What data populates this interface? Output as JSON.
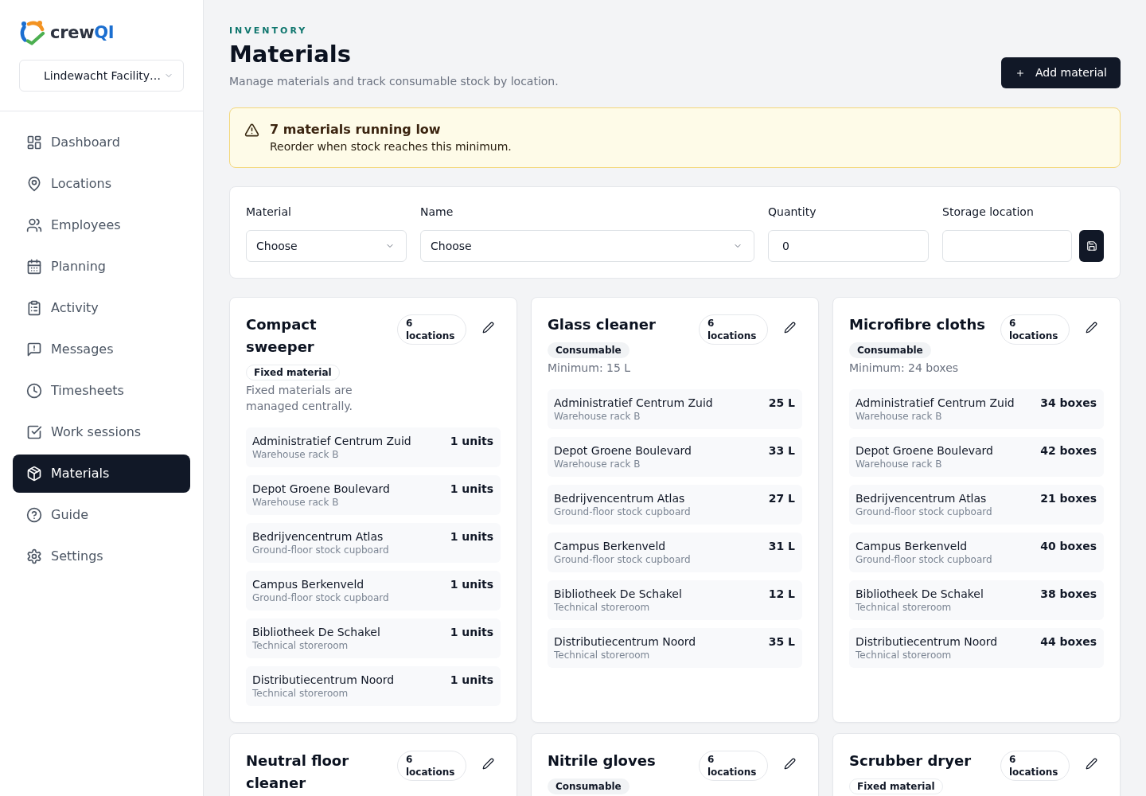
{
  "sidebar": {
    "logo": {
      "text": "crew",
      "accent": "QI"
    },
    "organization": {
      "value": "Lindewacht Facility…"
    },
    "nav": [
      {
        "label": "Dashboard",
        "selected": false
      },
      {
        "label": "Locations",
        "selected": false
      },
      {
        "label": "Employees",
        "selected": false
      },
      {
        "label": "Planning",
        "selected": false
      },
      {
        "label": "Activity",
        "selected": false
      },
      {
        "label": "Messages",
        "selected": false
      },
      {
        "label": "Timesheets",
        "selected": false
      },
      {
        "label": "Work sessions",
        "selected": false
      },
      {
        "label": "Materials",
        "selected": true
      },
      {
        "label": "Guide",
        "selected": false
      },
      {
        "label": "Settings",
        "selected": false
      }
    ]
  },
  "header": {
    "eyebrow": "INVENTORY",
    "title": "Materials",
    "subtitle": "Manage materials and track consumable stock by location.",
    "action": "Add material"
  },
  "alert": {
    "title": "7 materials running low",
    "message": "Reorder when stock reaches this minimum."
  },
  "stock_form": {
    "fields": [
      {
        "kind": "select",
        "label": "Material",
        "value": "Choose"
      },
      {
        "kind": "select",
        "label": "Name",
        "value": "Choose"
      },
      {
        "kind": "input",
        "label": "Quantity",
        "value": "0"
      },
      {
        "kind": "input",
        "label": "Storage location"
      }
    ]
  },
  "materials": [
    {
      "name": "Compact sweeper",
      "locations": "6 locations",
      "type": {
        "kind": "fixed",
        "label": "Fixed material"
      },
      "note": "Fixed materials are managed centrally.",
      "stock": [
        {
          "location": "Administratief Centrum Zuid",
          "storage": "Warehouse rack B",
          "quantity": "1 units"
        },
        {
          "location": "Depot Groene Boulevard",
          "storage": "Warehouse rack B",
          "quantity": "1 units"
        },
        {
          "location": "Bedrijvencentrum Atlas",
          "storage": "Ground-floor stock cupboard",
          "quantity": "1 units"
        },
        {
          "location": "Campus Berkenveld",
          "storage": "Ground-floor stock cupboard",
          "quantity": "1 units"
        },
        {
          "location": "Bibliotheek De Schakel",
          "storage": "Technical storeroom",
          "quantity": "1 units"
        },
        {
          "location": "Distributiecentrum Noord",
          "storage": "Technical storeroom",
          "quantity": "1 units"
        }
      ]
    },
    {
      "name": "Glass cleaner",
      "locations": "6 locations",
      "type": {
        "kind": "consumable",
        "label": "Consumable"
      },
      "note": "Minimum: 15 L",
      "stock": [
        {
          "location": "Administratief Centrum Zuid",
          "storage": "Warehouse rack B",
          "quantity": "25 L"
        },
        {
          "location": "Depot Groene Boulevard",
          "storage": "Warehouse rack B",
          "quantity": "33 L"
        },
        {
          "location": "Bedrijvencentrum Atlas",
          "storage": "Ground-floor stock cupboard",
          "quantity": "27 L"
        },
        {
          "location": "Campus Berkenveld",
          "storage": "Ground-floor stock cupboard",
          "quantity": "31 L"
        },
        {
          "location": "Bibliotheek De Schakel",
          "storage": "Technical storeroom",
          "quantity": "12 L"
        },
        {
          "location": "Distributiecentrum Noord",
          "storage": "Technical storeroom",
          "quantity": "35 L"
        }
      ]
    },
    {
      "name": "Microfibre cloths",
      "locations": "6 locations",
      "type": {
        "kind": "consumable",
        "label": "Consumable"
      },
      "note": "Minimum: 24 boxes",
      "stock": [
        {
          "location": "Administratief Centrum Zuid",
          "storage": "Warehouse rack B",
          "quantity": "34 boxes"
        },
        {
          "location": "Depot Groene Boulevard",
          "storage": "Warehouse rack B",
          "quantity": "42 boxes"
        },
        {
          "location": "Bedrijvencentrum Atlas",
          "storage": "Ground-floor stock cupboard",
          "quantity": "21 boxes"
        },
        {
          "location": "Campus Berkenveld",
          "storage": "Ground-floor stock cupboard",
          "quantity": "40 boxes"
        },
        {
          "location": "Bibliotheek De Schakel",
          "storage": "Technical storeroom",
          "quantity": "38 boxes"
        },
        {
          "location": "Distributiecentrum Noord",
          "storage": "Technical storeroom",
          "quantity": "44 boxes"
        }
      ]
    },
    {
      "name": "Neutral floor cleaner",
      "locations": "6 locations"
    },
    {
      "name": "Nitrile gloves",
      "locations": "6 locations",
      "type": {
        "kind": "consumable",
        "label": "Consumable"
      }
    },
    {
      "name": "Scrubber dryer",
      "locations": "6 locations",
      "type": {
        "kind": "fixed",
        "label": "Fixed material"
      }
    }
  ]
}
